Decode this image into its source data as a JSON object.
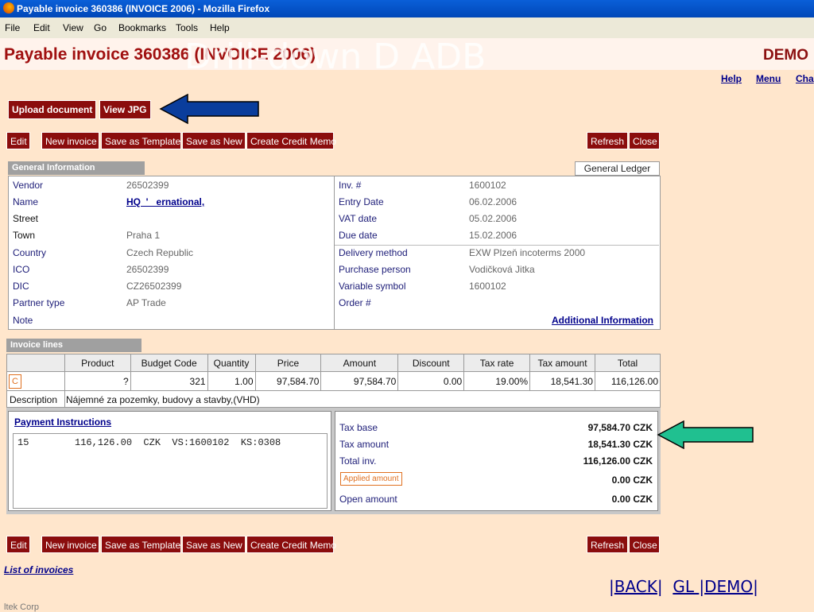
{
  "window": {
    "title": "Payable invoice 360386 (INVOICE 2006) - Mozilla Firefox"
  },
  "menu": [
    "File",
    "Edit",
    "View",
    "Go",
    "Bookmarks",
    "Tools",
    "Help"
  ],
  "header": {
    "title": "Payable invoice 360386 (INVOICE 2006)",
    "overlay": "Drill-down D ADB",
    "brand": "DEMO"
  },
  "top_links": [
    "Help",
    "Menu",
    "Cha"
  ],
  "doc_buttons": {
    "upload": "Upload document",
    "view": "View JPG"
  },
  "actions": {
    "edit": "Edit",
    "new_invoice": "New invoice",
    "save_template": "Save as Template",
    "save_new": "Save as New",
    "credit_memo": "Create Credit Memo",
    "refresh": "Refresh",
    "close": "Close"
  },
  "general": {
    "tab": "General Information",
    "gl_tab": "General Ledger",
    "left": {
      "vendor_label": "Vendor",
      "vendor": "26502399",
      "name_label": "Name",
      "name": "HQ  '   ernational,",
      "street_label": "Street",
      "street": "",
      "town_label": "Town",
      "town": "Praha 1",
      "country_label": "Country",
      "country": "Czech Republic",
      "ico_label": "ICO",
      "ico": "26502399",
      "dic_label": "DIC",
      "dic": "CZ26502399",
      "partner_label": "Partner type",
      "partner": "AP Trade",
      "note_label": "Note"
    },
    "right": {
      "inv_label": "Inv. #",
      "inv": "1600102",
      "entry_label": "Entry Date",
      "entry": "06.02.2006",
      "vat_label": "VAT date",
      "vat": "05.02.2006",
      "due_label": "Due date",
      "due": "15.02.2006",
      "delivery_label": "Delivery method",
      "delivery": "EXW Plzeň incoterms 2000",
      "purchase_label": "Purchase person",
      "purchase": "Vodičková Jitka",
      "variable_label": "Variable symbol",
      "variable": "1600102",
      "order_label": "Order #",
      "additional": "Additional Information"
    }
  },
  "lines": {
    "tab": "Invoice lines",
    "headers": [
      "",
      "Product",
      "Budget Code",
      "Quantity",
      "Price",
      "Amount",
      "Discount",
      "Tax rate",
      "Tax amount",
      "Total"
    ],
    "row": {
      "c": "C",
      "product": "?",
      "budget": "321",
      "quantity": "1.00",
      "price": "97,584.70",
      "amount": "97,584.70",
      "discount": "0.00",
      "tax_rate": "19.00%",
      "tax_amount": "18,541.30",
      "total": "116,126.00"
    },
    "description_label": "Description",
    "description": "Nájemné za pozemky, budovy a stavby,(VHD)"
  },
  "payment": {
    "title": "Payment Instructions",
    "line": "15        116,126.00  CZK  VS:1600102  KS:0308"
  },
  "totals": {
    "tax_base_label": "Tax base",
    "tax_base": "97,584.70  CZK",
    "tax_amount_label": "Tax amount",
    "tax_amount": "18,541.30  CZK",
    "total_label": "Total inv.",
    "total": "116,126.00  CZK",
    "applied_label": "Applied amount",
    "applied": "0.00  CZK",
    "open_label": "Open amount",
    "open": "0.00  CZK"
  },
  "bottom": {
    "list_link": "List of invoices",
    "back": "BACK",
    "gl": "GL ",
    "demo": "DEMO",
    "footer": "ltek Corp"
  },
  "colors": {
    "accent": "#8b0d0d",
    "page_bg": "#ffe6cc",
    "link": "#00008b",
    "blue_arrow": "#0a3d9c",
    "green_arrow": "#20c090"
  }
}
